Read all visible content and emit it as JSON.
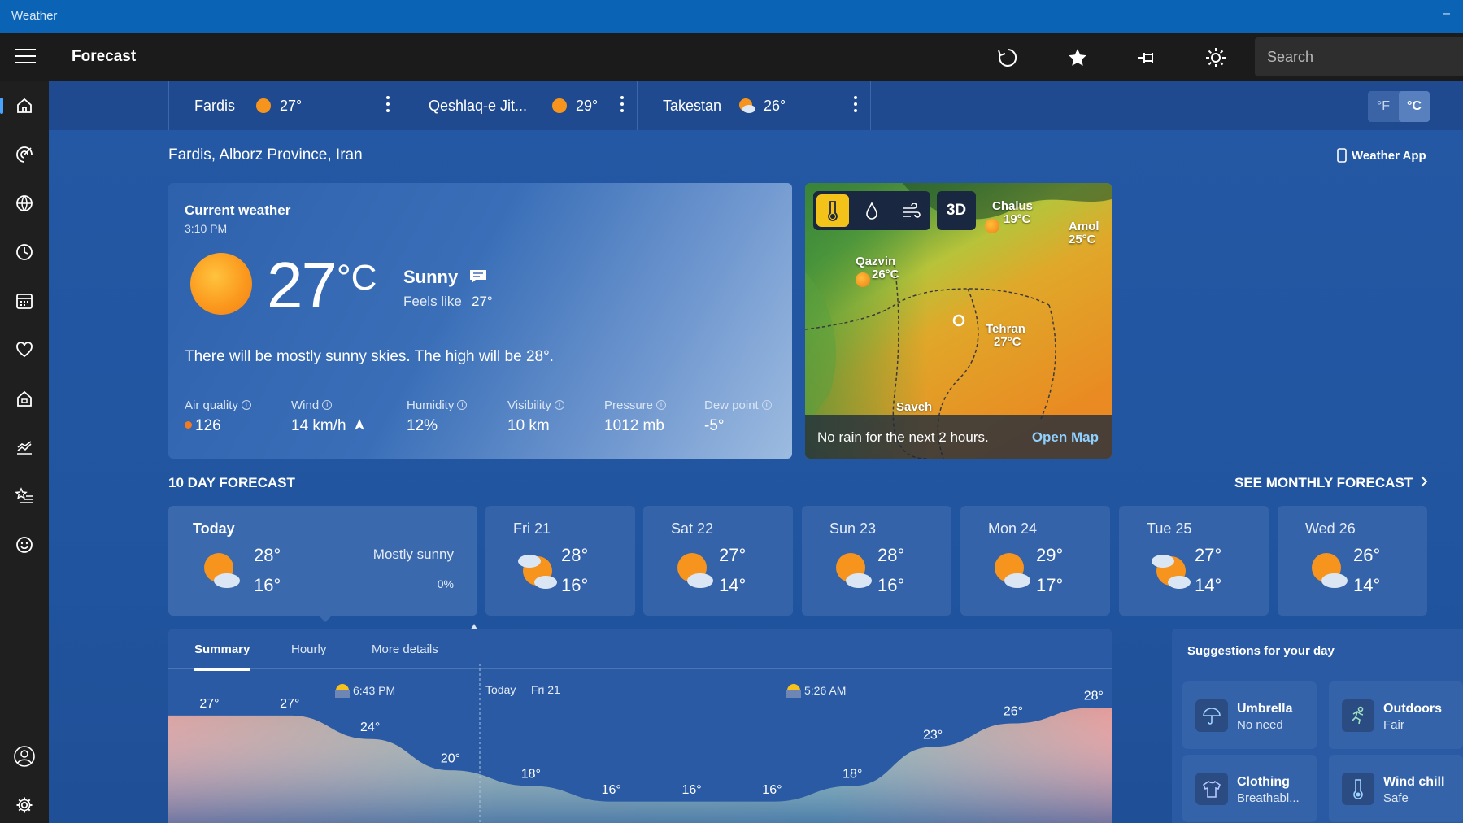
{
  "app": {
    "title": "Weather",
    "page_title": "Forecast"
  },
  "search": {
    "placeholder": "Search"
  },
  "toolbar": {
    "icons": [
      "refresh-icon",
      "star-icon",
      "pin-icon",
      "brightness-icon"
    ]
  },
  "sidebar": {
    "icons": [
      "home-icon",
      "radar-icon",
      "globe-icon",
      "clock-icon",
      "calendar-icon",
      "heart-icon",
      "house-icon",
      "chart-icon",
      "star-list-icon",
      "smiley-icon",
      "account-icon",
      "settings-icon"
    ]
  },
  "locations": [
    {
      "name": "Fardis",
      "temp": "27°"
    },
    {
      "name": "Qeshlaq-e Jit...",
      "temp": "29°"
    },
    {
      "name": "Takestan",
      "temp": "26°"
    }
  ],
  "units": {
    "f": "°F",
    "c": "°C"
  },
  "place": "Fardis, Alborz Province, Iran",
  "weather_app_link": "Weather App",
  "current": {
    "heading": "Current weather",
    "time": "3:10 PM",
    "temp": "27",
    "unit": "°C",
    "condition": "Sunny",
    "feels_label": "Feels like",
    "feels_value": "27°",
    "description": "There will be mostly sunny skies. The high will be 28°.",
    "details": [
      {
        "label": "Air quality",
        "value": "126"
      },
      {
        "label": "Wind",
        "value": "14 km/h"
      },
      {
        "label": "Humidity",
        "value": "12%"
      },
      {
        "label": "Visibility",
        "value": "10 km"
      },
      {
        "label": "Pressure",
        "value": "1012 mb"
      },
      {
        "label": "Dew point",
        "value": "-5°"
      }
    ]
  },
  "map": {
    "three_d": "3D",
    "cities": [
      {
        "name": "Chalus",
        "temp": "19°C"
      },
      {
        "name": "Amol",
        "temp": "25°C"
      },
      {
        "name": "Qazvin",
        "temp": "26°C"
      },
      {
        "name": "Tehran",
        "temp": "27°C"
      },
      {
        "name": "Saveh",
        "temp": ""
      }
    ],
    "footer_text": "No rain for the next 2 hours.",
    "open_map": "Open Map"
  },
  "forecast": {
    "heading": "10 DAY FORECAST",
    "see_monthly": "SEE MONTHLY FORECAST",
    "today": {
      "day": "Today",
      "hi": "28°",
      "lo": "16°",
      "condition": "Mostly sunny",
      "precip": "0%"
    },
    "days": [
      {
        "day": "Fri 21",
        "hi": "28°",
        "lo": "16°"
      },
      {
        "day": "Sat 22",
        "hi": "27°",
        "lo": "14°"
      },
      {
        "day": "Sun 23",
        "hi": "28°",
        "lo": "16°"
      },
      {
        "day": "Mon 24",
        "hi": "29°",
        "lo": "17°"
      },
      {
        "day": "Tue 25",
        "hi": "27°",
        "lo": "14°"
      },
      {
        "day": "Wed 26",
        "hi": "26°",
        "lo": "14°"
      }
    ]
  },
  "summary": {
    "tabs": [
      "Summary",
      "Hourly",
      "More details"
    ],
    "sunset": "6:43 PM",
    "today_label": "Today",
    "next_label": "Fri 21",
    "sunrise": "5:26 AM"
  },
  "chart_data": {
    "type": "area",
    "x": [
      "p1",
      "p2",
      "p3",
      "p4",
      "p5",
      "p6",
      "p7",
      "p8",
      "p9",
      "p10",
      "p11",
      "p12"
    ],
    "values": [
      27,
      27,
      24,
      20,
      18,
      16,
      16,
      16,
      18,
      23,
      26,
      28
    ],
    "labels": [
      "27°",
      "27°",
      "24°",
      "20°",
      "18°",
      "16°",
      "16°",
      "16°",
      "18°",
      "23°",
      "26°",
      "28°"
    ],
    "ylim": [
      14,
      30
    ]
  },
  "suggestions": {
    "heading": "Suggestions for your day",
    "items": [
      {
        "title": "Umbrella",
        "value": "No need"
      },
      {
        "title": "Outdoors",
        "value": "Fair"
      },
      {
        "title": "Clothing",
        "value": "Breathabl..."
      },
      {
        "title": "Wind chill",
        "value": "Safe"
      }
    ]
  },
  "colors": {
    "accent": "#4aa3ff",
    "titlebar": "#0b63b6",
    "sun": "#f59a1f",
    "link": "#8fd0ff"
  }
}
